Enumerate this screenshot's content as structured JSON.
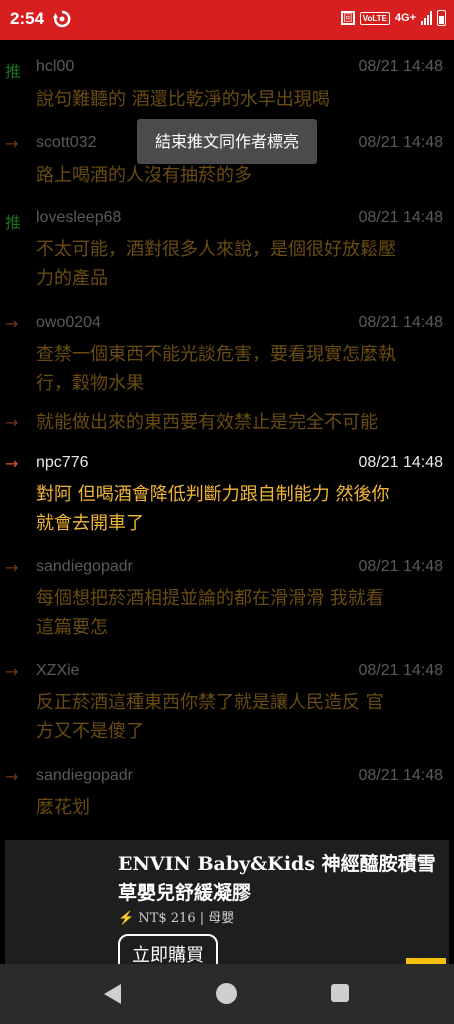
{
  "status_bar": {
    "time": "2:54",
    "volte": "VoLTE",
    "network": "4G+",
    "box_icon": "回"
  },
  "toast": "結束推文同作者標亮",
  "comments": [
    {
      "tag": "推",
      "user": "hcl00",
      "time": "08/21 14:48",
      "lines": [
        "說句難聽的  酒還比乾淨的水早出現喝"
      ]
    },
    {
      "tag": "→",
      "user": "scott032",
      "time": "08/21 14:48",
      "lines": [
        "路上喝酒的人沒有抽菸的多"
      ]
    },
    {
      "tag": "推",
      "user": "lovesleep68",
      "time": "08/21 14:48",
      "lines": [
        "不太可能，酒對很多人來說，是個很好放鬆壓",
        "力的產品"
      ]
    },
    {
      "tag": "→",
      "user": "owo0204",
      "time": "08/21 14:48",
      "lines": [
        "查禁一個東西不能光談危害，要看現實怎麼執",
        "行，穀物水果"
      ]
    },
    {
      "tag": "→",
      "user": "",
      "time": "",
      "lines": [
        "就能做出來的東西要有效禁止是完全不可能"
      ]
    },
    {
      "tag": "→",
      "user": "npc776",
      "time": "08/21 14:48",
      "lines": [
        "對阿  但喝酒會降低判斷力跟自制能力  然後你",
        "就會去開車了"
      ]
    },
    {
      "tag": "→",
      "user": "sandiegopadr",
      "time": "08/21 14:48",
      "lines": [
        "每個想把菸酒相提並論的都在滑滑滑  我就看",
        "這篇要怎"
      ]
    },
    {
      "tag": "→",
      "user": "XZXie",
      "time": "08/21 14:48",
      "lines": [
        "反正菸酒這種東西你禁了就是讓人民造反    官",
        "方又不是傻了"
      ]
    },
    {
      "tag": "→",
      "user": "sandiegopadr",
      "time": "08/21 14:48",
      "lines": [
        "麼花划"
      ]
    }
  ],
  "ad": {
    "title_line1": "ENVIN Baby&Kids 神經醯胺積雪",
    "title_line2": "草嬰兒舒緩凝膠",
    "bolt": "⚡",
    "price": "NT$ 216",
    "separator": "|",
    "category": "母嬰",
    "cta": "立即購買",
    "accent_color": "#f4c20d"
  },
  "nav": {
    "back_icon": "back-triangle",
    "home_icon": "home-circle",
    "recent_icon": "recent-square"
  },
  "colors": {
    "status_bar": "#d81f1f",
    "highlight_text": "#f2b637",
    "dim_text": "#6a4c12",
    "push_tag": "#1b6e1b",
    "arrow_tag": "#e0562b"
  }
}
